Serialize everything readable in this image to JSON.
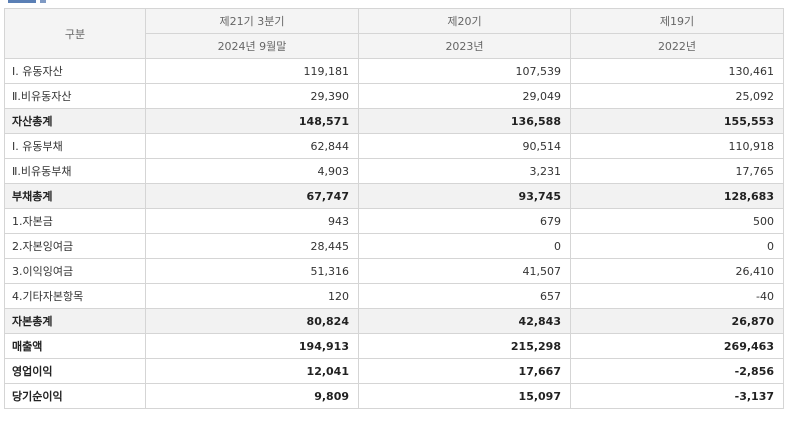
{
  "header": {
    "col0": "구분",
    "periods": [
      "제21기 3분기",
      "제20기",
      "제19기"
    ],
    "dates": [
      "2024년 9월말",
      "2023년",
      "2022년"
    ]
  },
  "rows": [
    {
      "label": "Ⅰ. 유동자산",
      "values": [
        "119,181",
        "107,539",
        "130,461"
      ],
      "style": "normal"
    },
    {
      "label": "Ⅱ.비유동자산",
      "values": [
        "29,390",
        "29,049",
        "25,092"
      ],
      "style": "normal"
    },
    {
      "label": "자산총계",
      "values": [
        "148,571",
        "136,588",
        "155,553"
      ],
      "style": "total"
    },
    {
      "label": "Ⅰ. 유동부채",
      "values": [
        "62,844",
        "90,514",
        "110,918"
      ],
      "style": "normal"
    },
    {
      "label": "Ⅱ.비유동부채",
      "values": [
        "4,903",
        "3,231",
        "17,765"
      ],
      "style": "normal"
    },
    {
      "label": "부채총계",
      "values": [
        "67,747",
        "93,745",
        "128,683"
      ],
      "style": "total"
    },
    {
      "label": "1.자본금",
      "values": [
        "943",
        "679",
        "500"
      ],
      "style": "normal"
    },
    {
      "label": "2.자본잉여금",
      "values": [
        "28,445",
        "0",
        "0"
      ],
      "style": "normal"
    },
    {
      "label": "3.이익잉여금",
      "values": [
        "51,316",
        "41,507",
        "26,410"
      ],
      "style": "normal"
    },
    {
      "label": "4.기타자본항목",
      "values": [
        "120",
        "657",
        "-40"
      ],
      "style": "normal"
    },
    {
      "label": "자본총계",
      "values": [
        "80,824",
        "42,843",
        "26,870"
      ],
      "style": "total"
    },
    {
      "label": "매출액",
      "values": [
        "194,913",
        "215,298",
        "269,463"
      ],
      "style": "bold"
    },
    {
      "label": "영업이익",
      "values": [
        "12,041",
        "17,667",
        "-2,856"
      ],
      "style": "bold"
    },
    {
      "label": "당기순이익",
      "values": [
        "9,809",
        "15,097",
        "-3,137"
      ],
      "style": "bold"
    }
  ]
}
